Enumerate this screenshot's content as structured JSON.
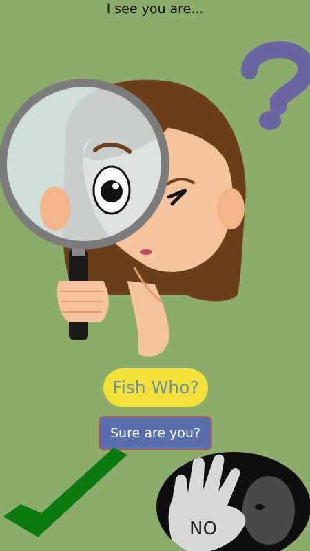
{
  "header": {
    "title": "I see you are..."
  },
  "buttons": {
    "fish_who": "Fish Who?",
    "sure_are_you": "Sure are you?"
  },
  "images": {
    "question": "question-mark-icon",
    "girl": "girl-with-magnifying-glass",
    "check": "check-mark-icon",
    "no_sign": "no-hand-photo",
    "no_text": "NO"
  },
  "colors": {
    "background": "#8bac6b",
    "question_mark": "#6b65a3",
    "fish_button": "#f2e237",
    "fish_text": "#6f8fa6",
    "sure_button": "#5a6fb0",
    "sure_border": "#b65a4f",
    "check": "#0b7a10"
  }
}
